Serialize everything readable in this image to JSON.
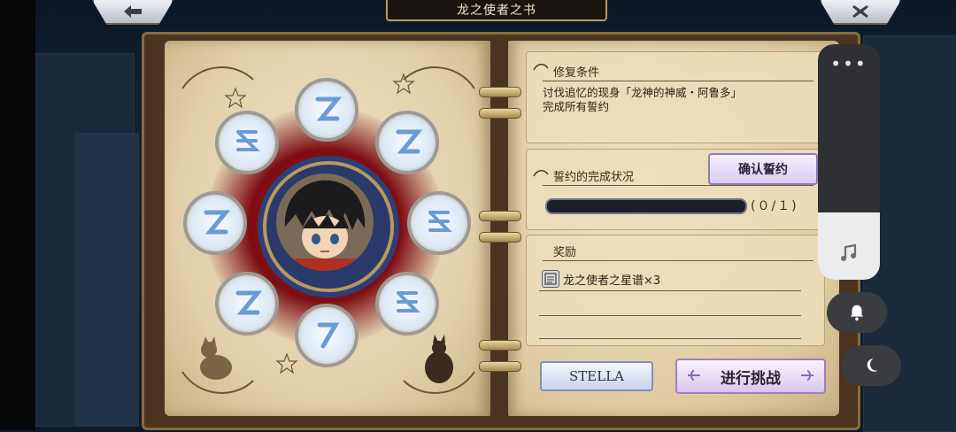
{
  "header": {
    "title": "龙之使者之书",
    "back_icon": "back-arrow-icon",
    "close_icon": "close-icon"
  },
  "conditions": {
    "title": "修复条件",
    "line1": "讨伐追忆的现身「龙神的神威・阿鲁多」",
    "line2": "完成所有誓约"
  },
  "oath": {
    "title": "誓约的完成状况",
    "confirm_label": "确认誓约",
    "progress_text": "(０/１)",
    "progress_fraction": 0.0
  },
  "reward": {
    "title": "奖励",
    "item": "龙之使者之星谱×3"
  },
  "buttons": {
    "stella": "STELLA",
    "challenge": "进行挑战"
  },
  "overlay": {
    "more": "•••",
    "icons": [
      "music-note-icon",
      "bell-icon",
      "moon-icon"
    ]
  },
  "colors": {
    "accent_purple": "#9b7fc1",
    "progress_fill": "#7fc1ff",
    "magic_red": "#b0141c"
  }
}
